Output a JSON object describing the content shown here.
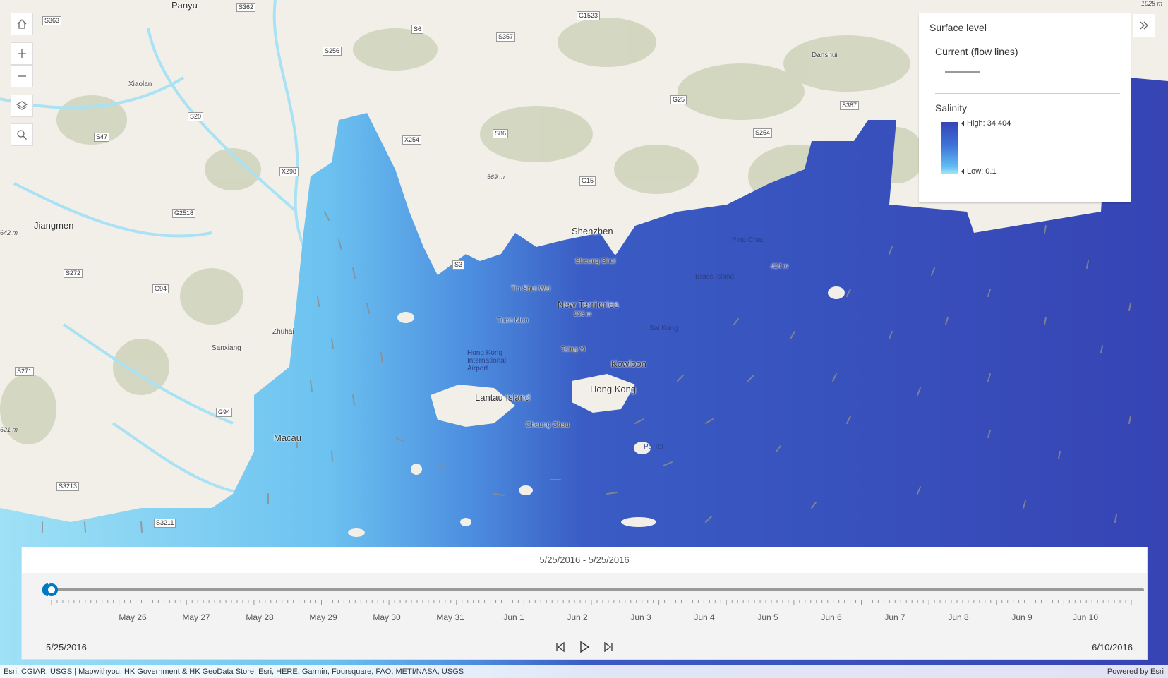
{
  "map": {
    "places": [
      {
        "name": "Panyu"
      },
      {
        "name": "Xiaolan"
      },
      {
        "name": "Jiangmen"
      },
      {
        "name": "Zhuhai"
      },
      {
        "name": "Sanxiang"
      },
      {
        "name": "Macau"
      },
      {
        "name": "Shenzhen"
      },
      {
        "name": "Sheung Shui"
      },
      {
        "name": "Tin Shui Wai"
      },
      {
        "name": "New Territories"
      },
      {
        "name": "Tuen Mun"
      },
      {
        "name": "Tsing Yi"
      },
      {
        "name": "Kowloon"
      },
      {
        "name": "Hong Kong"
      },
      {
        "name": "Lantau Island"
      },
      {
        "name": "Cheung Chau"
      },
      {
        "name": "Hong Kong International Airport"
      },
      {
        "name": "Sai Kung"
      },
      {
        "name": "Ping Chau"
      },
      {
        "name": "Brass Island"
      },
      {
        "name": "Danshui"
      },
      {
        "name": "Po Toi"
      }
    ],
    "elevations": [
      "569 m",
      "936 m",
      "414 m",
      "642 m",
      "621 m",
      "1028 m"
    ],
    "road_shields": [
      "S362",
      "S363",
      "S256",
      "G1523",
      "S357",
      "S6",
      "S20",
      "S47",
      "X254",
      "S86",
      "G25",
      "S387",
      "S254",
      "X298",
      "G2518",
      "G15",
      "S3",
      "S272",
      "G94",
      "S271",
      "G94",
      "S3213",
      "S3211"
    ]
  },
  "controls": {
    "home": "home-icon",
    "zoom_in": "plus-icon",
    "zoom_out": "minus-icon",
    "layers": "layers-icon",
    "search": "search-icon"
  },
  "legend": {
    "title": "Surface level",
    "current_label": "Current (flow lines)",
    "salinity_label": "Salinity",
    "high_label": "High: 34,404",
    "low_label": "Low: 0.1",
    "colors": {
      "high": "#3644b4",
      "low": "#a8e6f8",
      "flow": "#9a9a9a"
    }
  },
  "time_slider": {
    "range_text": "5/25/2016  -  5/25/2016",
    "start_date": "5/25/2016",
    "end_date": "6/10/2016",
    "tick_labels": [
      "May 26",
      "May 27",
      "May 28",
      "May 29",
      "May 30",
      "May 31",
      "Jun 1",
      "Jun 2",
      "Jun 3",
      "Jun 4",
      "Jun 5",
      "Jun 6",
      "Jun 7",
      "Jun 8",
      "Jun 9",
      "Jun 10"
    ],
    "position": 0,
    "accent": "#0079c1"
  },
  "attribution": {
    "text": "Esri, CGIAR, USGS | Mapwithyou, HK Government & HK GeoData Store, Esri, HERE, Garmin, Foursquare, FAO, METI/NASA, USGS",
    "powered": "Powered by Esri"
  }
}
